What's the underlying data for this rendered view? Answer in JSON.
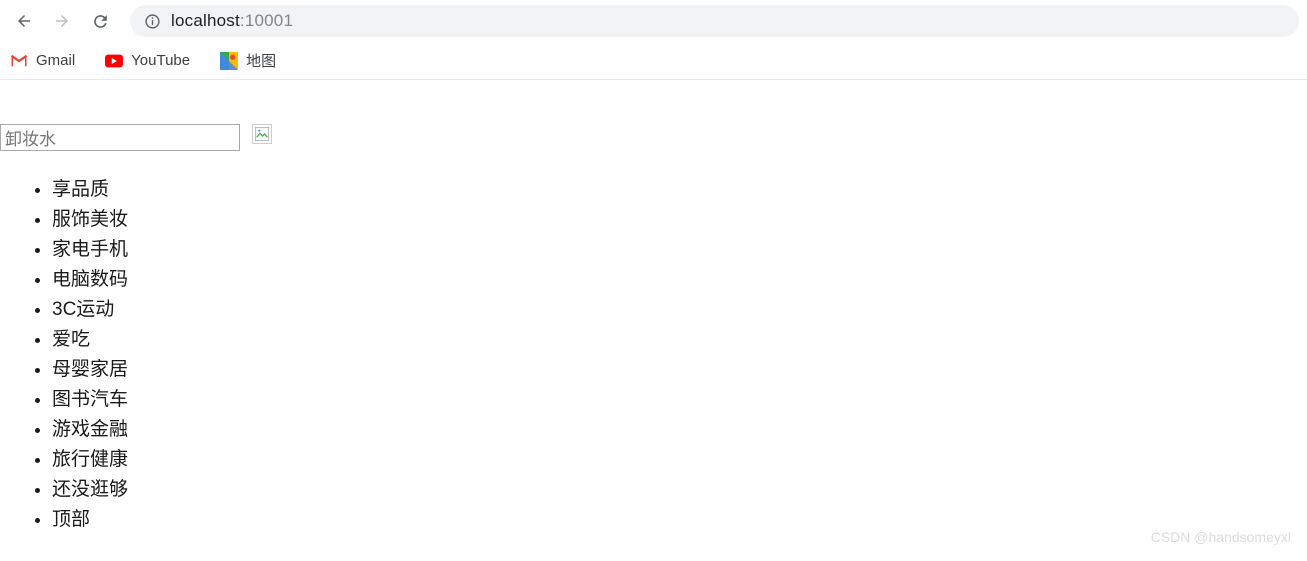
{
  "browser": {
    "url_host": "localhost",
    "url_port": ":10001"
  },
  "bookmarks": [
    {
      "label": "Gmail",
      "icon": "gmail"
    },
    {
      "label": "YouTube",
      "icon": "youtube"
    },
    {
      "label": "地图",
      "icon": "maps"
    }
  ],
  "page": {
    "search_value": "卸妆水",
    "categories": [
      "享品质",
      "服饰美妆",
      "家电手机",
      "电脑数码",
      "3C运动",
      "爱吃",
      "母婴家居",
      "图书汽车",
      "游戏金融",
      "旅行健康",
      "还没逛够",
      "顶部"
    ]
  },
  "watermark": "CSDN @handsomeyxl"
}
